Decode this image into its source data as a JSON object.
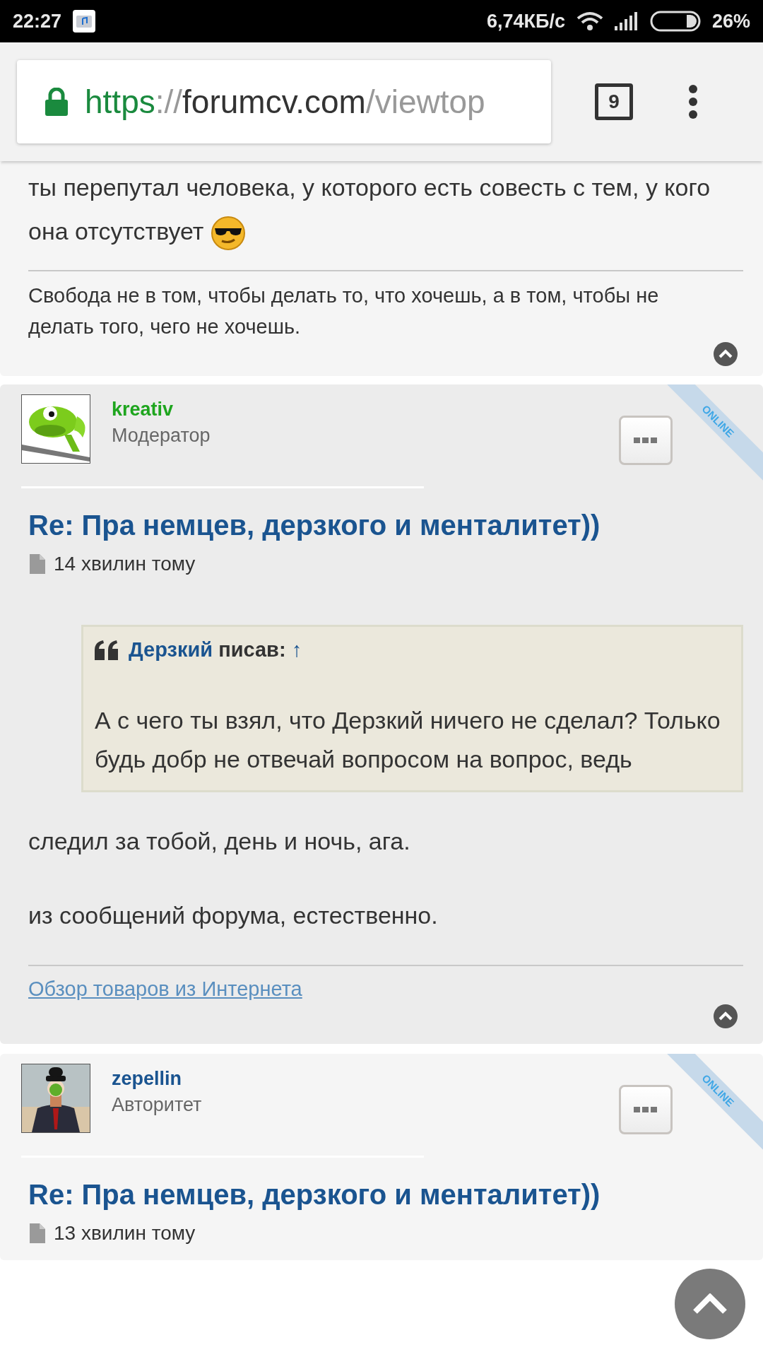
{
  "status_bar": {
    "time": "22:27",
    "speed": "6,74КБ/с",
    "battery": "26%"
  },
  "browser": {
    "url": {
      "scheme": "https",
      "separator": "://",
      "host": "forumcv.com",
      "path": "/viewtop"
    },
    "tab_count": "9"
  },
  "posts": [
    {
      "kind": "tail",
      "text": "ты перепутал человека, у которого есть совесть с тем, у кого она отсутствует",
      "signature": "Свобода не в том, чтобы делать то, что хочешь, а в том, чтобы не делать того, чего не хочешь.",
      "signature_is_link": false
    },
    {
      "kind": "full",
      "author": {
        "name": "kreativ",
        "role": "Модератор",
        "color": "#1ea51e"
      },
      "online": true,
      "online_label": "ONLINE",
      "title": "Re: Пра немцев, дерзкого и менталитет))",
      "time": "14 хвилин тому",
      "quote": {
        "author": "Дерзкий",
        "verb": "писав:",
        "link": "↑",
        "text": "А с чего ты взял, что Дерзкий ничего не сделал? Только будь добр не отвечай вопросом на вопрос, ведь"
      },
      "paragraphs": [
        "следил за тобой, день и ночь, ага.",
        "из сообщений форума, естественно."
      ],
      "signature": "Обзор товаров из Интернета",
      "signature_is_link": true
    },
    {
      "kind": "full",
      "author": {
        "name": "zepellin",
        "role": "Авторитет",
        "color": "#1a5490"
      },
      "online": true,
      "online_label": "ONLINE",
      "title": "Re: Пра немцев, дерзкого и менталитет))",
      "time": "13 хвилин тому"
    }
  ]
}
